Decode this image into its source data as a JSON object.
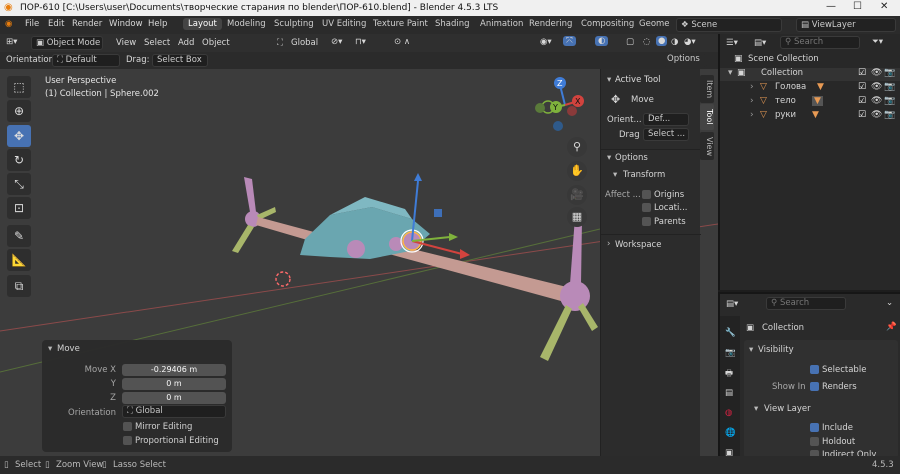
{
  "window": {
    "title": "ПОР-610 [C:\\Users\\user\\Documents\\творческие старания по blender\\ПОР-610.blend] - Blender 4.5.3 LTS",
    "minimize": "—",
    "maximize": "☐",
    "close": "✕"
  },
  "menu": {
    "items": [
      "File",
      "Edit",
      "Render",
      "Window",
      "Help"
    ],
    "workspace_tabs": [
      "Layout",
      "Modeling",
      "Sculpting",
      "UV Editing",
      "Texture Paint",
      "Shading",
      "Animation",
      "Rendering",
      "Compositing",
      "Geome"
    ],
    "scene": "Scene",
    "view_layer": "ViewLayer"
  },
  "viewport_header": {
    "mode": "Object Mode",
    "menus": [
      "View",
      "Select",
      "Add",
      "Object"
    ],
    "transform_orientation": "Global",
    "orientation_label": "Orientation:",
    "orientation_value": "Default",
    "drag_label": "Drag:",
    "drag_value": "Select Box",
    "options": "Options"
  },
  "viewport": {
    "perspective": "User Perspective",
    "collection_info": "(1) Collection | Sphere.002",
    "gizmo_axes": [
      "Z",
      "Y",
      "X"
    ]
  },
  "npanel": {
    "tabs": [
      "Item",
      "Tool",
      "View"
    ],
    "active_tool_header": "Active Tool",
    "tool_name": "Move",
    "orient_label": "Orient...",
    "orient_value": "Def...",
    "drag_label": "Drag",
    "drag_value": "Select ...",
    "options_header": "Options",
    "transform_header": "Transform",
    "affect_label": "Affect ...",
    "affect_options": [
      "Origins",
      "Locati...",
      "Parents"
    ],
    "workspace_header": "Workspace"
  },
  "operator_panel": {
    "title": "Move",
    "fields": [
      {
        "label": "Move X",
        "value": "-0.29406 m"
      },
      {
        "label": "Y",
        "value": "0 m"
      },
      {
        "label": "Z",
        "value": "0 m"
      }
    ],
    "orientation_label": "Orientation",
    "orientation_value": "Global",
    "mirror_editing": "Mirror Editing",
    "proportional_editing": "Proportional Editing"
  },
  "outliner": {
    "search_placeholder": "Search",
    "scene_collection": "Scene Collection",
    "collection": "Collection",
    "objects": [
      "Голова",
      "тело",
      "руки"
    ]
  },
  "properties": {
    "search_placeholder": "Search",
    "context": "Collection",
    "visibility_header": "Visibility",
    "selectable": "Selectable",
    "show_in_label": "Show In",
    "renders": "Renders",
    "view_layer_header": "View Layer",
    "include": "Include",
    "holdout": "Holdout",
    "indirect_only": "Indirect Only"
  },
  "statusbar": {
    "select": "Select",
    "zoom_view": "Zoom View",
    "lasso_select": "Lasso Select",
    "version": "4.5.3"
  },
  "colors": {
    "selected_blue": "#4772b3",
    "object_pink": "#c49a92",
    "object_teal": "#6aa6b0",
    "object_purple": "#b98ab8",
    "object_green": "#a8b66a",
    "axis_red": "#d2433e",
    "axis_green": "#7fb23c",
    "axis_blue": "#3f7cd7"
  }
}
